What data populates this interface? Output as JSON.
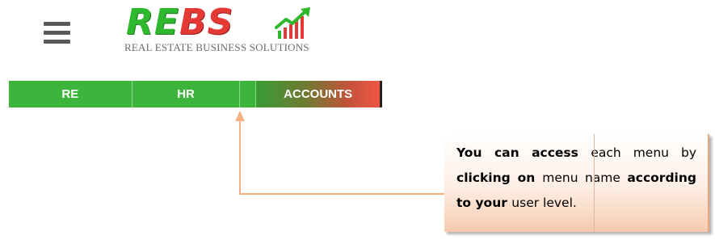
{
  "header": {
    "menu_icon": "hamburger-menu-icon",
    "logo": {
      "wordmark": "REBS",
      "tagline": "REAL ESTATE BUSINESS SOLUTIONS",
      "chart_icon": "growth-chart-icon"
    }
  },
  "menu": {
    "items": [
      {
        "label": "RE"
      },
      {
        "label": "HR"
      },
      {
        "label": ""
      },
      {
        "label": "ACCOUNTS"
      }
    ]
  },
  "callout": {
    "text_part1": "You can access ",
    "text_part2": "each menu by ",
    "text_part3": "clicking on ",
    "text_part4": "menu name ",
    "text_part5": "according to your ",
    "text_part6": "user level."
  },
  "colors": {
    "menu_green": "#3db53d",
    "accounts_gradient_end": "#ee5744",
    "logo_green": "#2eb82e",
    "logo_red": "#e53935",
    "arrow": "#f4b183"
  }
}
